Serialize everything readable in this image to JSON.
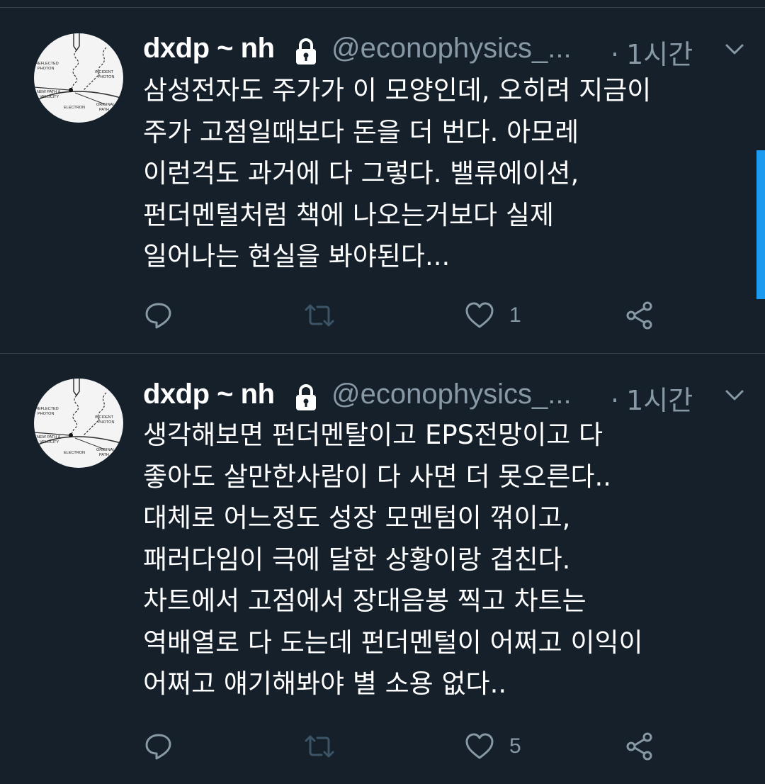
{
  "tweets": [
    {
      "name": "dxdp ~ nh",
      "handle": "@econophysics_...",
      "dot": "·",
      "time": "1시간",
      "lines": [
        "삼성전자도 주가가 이 모양인데, 오히려 지금이",
        "주가 고점일때보다 돈을 더 번다. 아모레",
        "이런걱도 과거에 다 그렇다. 밸류에이션,",
        "펀더멘털처럼 책에 나오는거보다 실제",
        "일어나는 현실을 봐야된다..."
      ],
      "likes": "1",
      "avatar_labels": [
        "REFLECTED",
        "PHOTON",
        "INCIDENT",
        "PHOTON",
        "NEW PATH &",
        "VELOCITY",
        "ELECTRON",
        "ORIGINAL",
        "PATH",
        "PECTED PATH"
      ]
    },
    {
      "name": "dxdp ~ nh",
      "handle": "@econophysics_...",
      "dot": "·",
      "time": "1시간",
      "lines": [
        "생각해보면 펀더멘탈이고 EPS전망이고 다",
        "좋아도 살만한사람이 다 사면 더 못오른다..",
        "대체로 어느정도 성장 모멘텀이 꺾이고,",
        "패러다임이 극에 달한 상황이랑 겹친다.",
        "차트에서 고점에서 장대음봉 찍고 차트는",
        "역배열로 다 도는데 펀더멘털이 어쩌고 이익이",
        "어쩌고 얘기해봐야 별 소용 없다.."
      ],
      "likes": "5",
      "avatar_labels": [
        "REFLECTED",
        "PHOTON",
        "INCIDENT",
        "PHOTON",
        "NEW PATH &",
        "VELOCITY",
        "ELECTRON",
        "ORIGINAL",
        "PATH",
        "PECTED PATH"
      ]
    }
  ],
  "icons": {
    "protected": "lock-icon",
    "more": "chevron-down-icon",
    "reply": "reply-icon",
    "retweet": "retweet-icon",
    "like": "heart-icon",
    "share": "share-icon"
  },
  "colors": {
    "background": "#15202b",
    "divider": "#38444d",
    "secondary_text": "#8899a6",
    "accent": "#1d9bf0"
  }
}
